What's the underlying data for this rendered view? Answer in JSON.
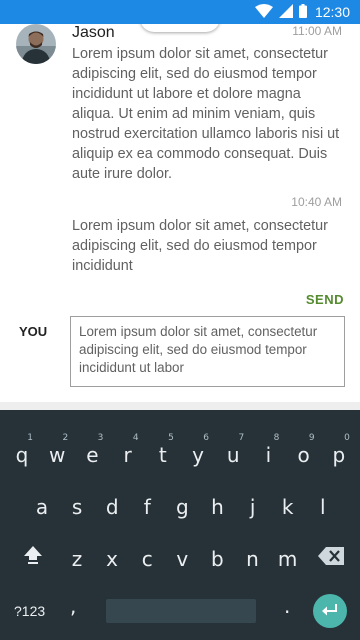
{
  "status_bar": {
    "time": "12:30",
    "icons": [
      "wifi-icon",
      "cellular-signal-icon",
      "battery-icon"
    ],
    "background": "#1e88e5"
  },
  "chat": {
    "messages": [
      {
        "sender": "Jason",
        "time": "11:00 AM",
        "text": "Lorem ipsum dolor sit amet, consectetur adipiscing elit, sed do eiusmod tempor incididunt ut labore et dolore magna aliqua. Ut enim ad minim veniam, quis nostrud exercitation ullamco laboris nisi ut aliquip ex ea commodo consequat. Duis aute irure dolor."
      },
      {
        "time": "10:40 AM",
        "text": "Lorem ipsum dolor sit amet, consectetur adipiscing elit, sed do eiusmod tempor incididunt"
      }
    ]
  },
  "compose": {
    "send_label": "SEND",
    "you_label": "YOU",
    "value": "Lorem ipsum dolor sit amet, consectetur adipiscing elit, sed do eiusmod tempor incididunt ut labor"
  },
  "keyboard": {
    "row1": [
      {
        "key": "q",
        "hint": "1"
      },
      {
        "key": "w",
        "hint": "2"
      },
      {
        "key": "e",
        "hint": "3"
      },
      {
        "key": "r",
        "hint": "4"
      },
      {
        "key": "t",
        "hint": "5"
      },
      {
        "key": "y",
        "hint": "6"
      },
      {
        "key": "u",
        "hint": "7"
      },
      {
        "key": "i",
        "hint": "8"
      },
      {
        "key": "o",
        "hint": "9"
      },
      {
        "key": "p",
        "hint": "0"
      }
    ],
    "row2": [
      "a",
      "s",
      "d",
      "f",
      "g",
      "h",
      "j",
      "k",
      "l"
    ],
    "row3": [
      "z",
      "x",
      "c",
      "v",
      "b",
      "n",
      "m"
    ],
    "symbols_label": "?123",
    "comma": ",",
    "period": ".",
    "accent": "#4db6ac"
  }
}
